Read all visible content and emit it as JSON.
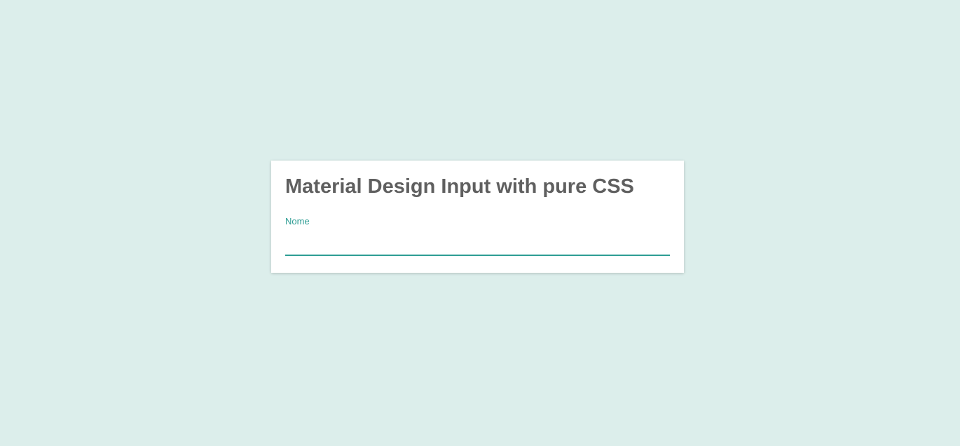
{
  "card": {
    "heading": "Material Design Input with pure CSS",
    "field": {
      "label": "Nome",
      "value": ""
    }
  },
  "colors": {
    "background": "#dceeeb",
    "accent": "#2e9d94",
    "heading": "#5f5f5f"
  }
}
